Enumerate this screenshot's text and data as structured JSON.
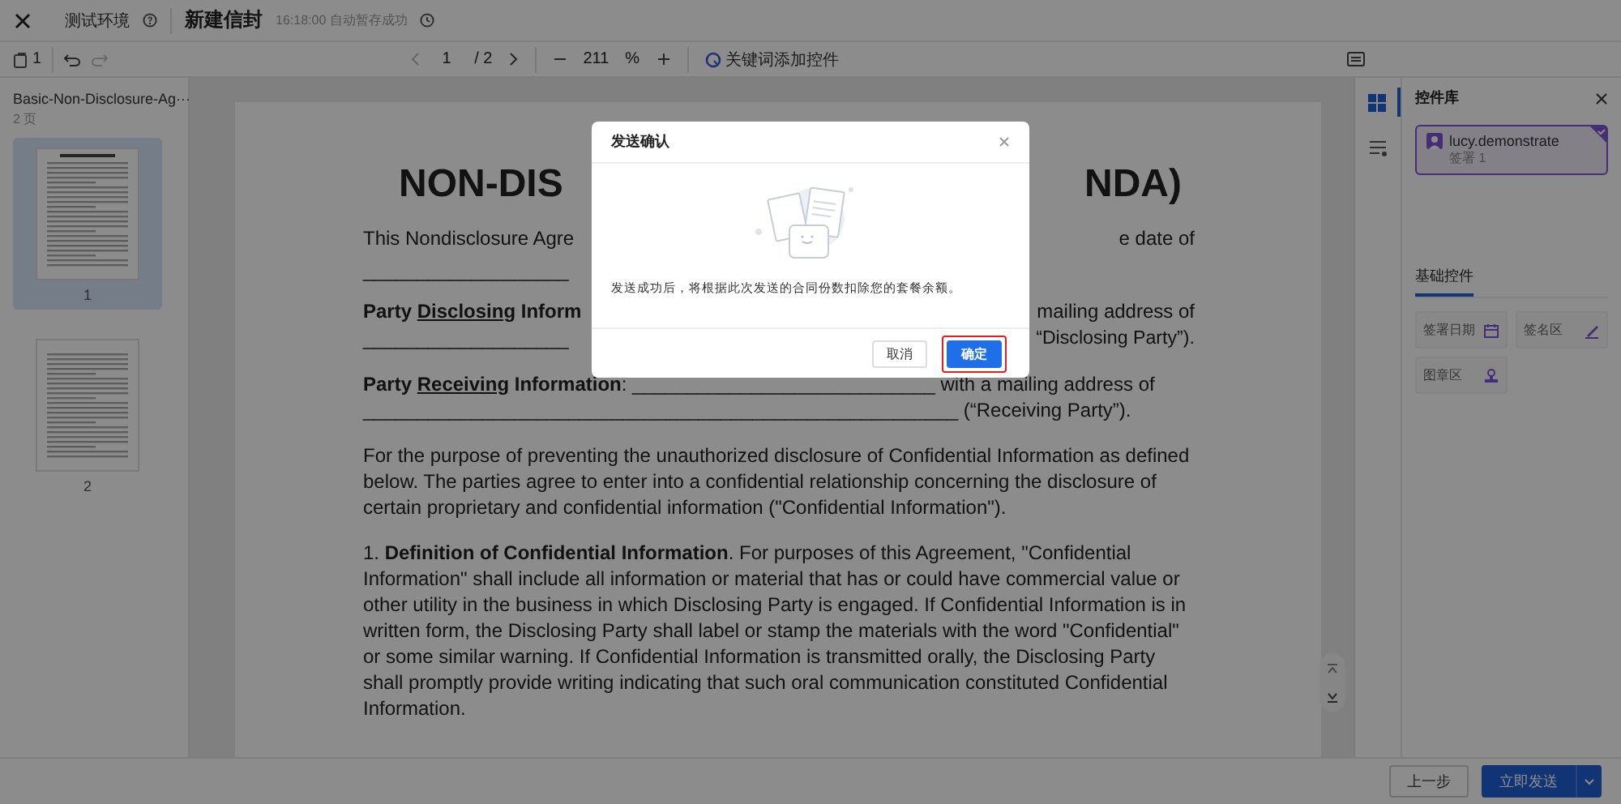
{
  "top_bar": {
    "environment": "测试环境",
    "title": "新建信封",
    "autosave": "16:18:00 自动暂存成功"
  },
  "toolbar": {
    "doc_count": "1",
    "redo_disabled": true,
    "page_current": "1",
    "page_total": "/ 2",
    "zoom": "211",
    "zoom_unit": "%",
    "keyword_button": "关键词添加控件"
  },
  "left_panel": {
    "file_name": "Basic-Non-Disclosure-Ag···",
    "page_count": "2 页",
    "pages": [
      {
        "label": "1",
        "selected": true
      },
      {
        "label": "2",
        "selected": false
      }
    ]
  },
  "document": {
    "title_left": "NON-DIS",
    "title_right": "NDA)",
    "lines": [
      {
        "left": [
          {
            "text": "This Nondisclosure Agre",
            "bold": false,
            "underline": false
          }
        ],
        "right": "e date of"
      },
      {
        "left": [
          {
            "text": "___________________",
            "bold": false,
            "underline": false
          }
        ]
      },
      {
        "left": [
          {
            "text": "Party ",
            "bold": true,
            "underline": false
          },
          {
            "text": "Disclosing",
            "bold": true,
            "underline": true
          },
          {
            "text": " Inform",
            "bold": true,
            "underline": false
          }
        ],
        "right": "mailing address of"
      },
      {
        "left": [
          {
            "text": "___________________",
            "bold": false,
            "underline": false
          }
        ],
        "right": "“Disclosing Party”)."
      },
      {
        "left": [
          {
            "text": "Party ",
            "bold": true,
            "underline": false
          },
          {
            "text": "Receiving",
            "bold": true,
            "underline": true
          },
          {
            "text": " Information",
            "bold": true,
            "underline": false
          },
          {
            "text": ": ____________________________ with a mailing address of",
            "bold": false,
            "underline": false
          }
        ]
      },
      {
        "left": [
          {
            "text": "_______________________________________________________ (“Receiving Party”).",
            "bold": false,
            "underline": false
          }
        ]
      }
    ],
    "paragraphs": [
      "For the purpose of preventing the unauthorized disclosure of Confidential Information as defined below. The parties agree to enter into a confidential relationship concerning the disclosure of certain proprietary and confidential information (\"Confidential Information\").",
      "1. **Definition of Confidential Information**. For purposes of this Agreement, \"Confidential Information\" shall include all information or material that has or could have commercial value or other utility in the business in which Disclosing Party is engaged. If Confidential Information is in written form, the Disclosing Party shall label or stamp the materials with the word \"Confidential\" or some similar warning. If Confidential Information is transmitted orally, the Disclosing Party shall promptly provide writing indicating that such oral communication constituted Confidential Information."
    ]
  },
  "side_tabs": [
    {
      "kind": "grid",
      "selected": true
    },
    {
      "kind": "list",
      "selected": false
    }
  ],
  "right_panel": {
    "title": "控件库",
    "signer": {
      "name": "lucy.demonstrate",
      "detail": "签署 1",
      "selected": true
    },
    "tabs": [
      {
        "label": "基础控件",
        "selected": true
      }
    ],
    "controls": [
      {
        "label": "签署日期",
        "kind": "date"
      },
      {
        "label": "签名区",
        "kind": "signature"
      },
      {
        "label": "图章区",
        "kind": "stamp"
      }
    ]
  },
  "footer": {
    "buttons": [
      {
        "label": "上一步",
        "kind": "secondary"
      },
      {
        "label": "立即发送",
        "kind": "primary"
      }
    ]
  },
  "dialog": {
    "title": "发送确认",
    "message": "发送成功后，将根据此次发送的合同份数扣除您的套餐余额。",
    "buttons": [
      {
        "label": "取消",
        "kind": "secondary",
        "highlighted": false
      },
      {
        "label": "确定",
        "kind": "primary",
        "highlighted": true
      }
    ]
  }
}
